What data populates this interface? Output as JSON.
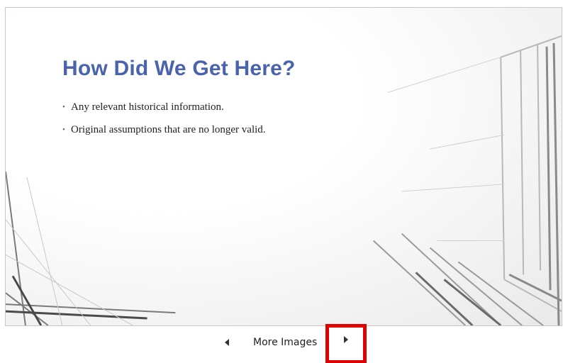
{
  "slide": {
    "title": "How Did We Get Here?",
    "bullets": [
      "Any relevant historical information.",
      "Original assumptions that are no longer valid."
    ],
    "bullet_marker": "•"
  },
  "navigation": {
    "label": "More Images",
    "prev_icon": "chevron-left-icon",
    "next_icon": "chevron-right-icon",
    "highlight_color": "#e00000"
  },
  "colors": {
    "title": "#4a63ad",
    "body_text": "#222222"
  }
}
